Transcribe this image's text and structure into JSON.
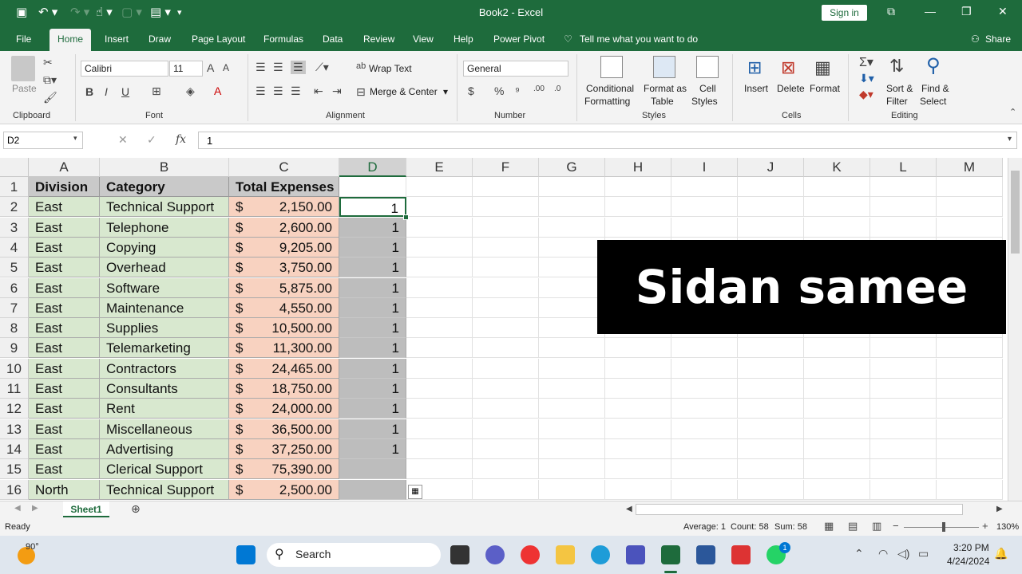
{
  "window": {
    "title": "Book2  -  Excel",
    "sign_in": "Sign in"
  },
  "tabs": [
    "File",
    "Home",
    "Insert",
    "Draw",
    "Page Layout",
    "Formulas",
    "Data",
    "Review",
    "View",
    "Help",
    "Power Pivot"
  ],
  "tell_me": "Tell me what you want to do",
  "share": "Share",
  "ribbon": {
    "clipboard": {
      "paste": "Paste",
      "label": "Clipboard"
    },
    "font": {
      "name": "Calibri",
      "size": "11",
      "label": "Font",
      "bold": "B",
      "italic": "I",
      "underline": "U"
    },
    "alignment": {
      "wrap_text": "Wrap Text",
      "merge_center": "Merge & Center",
      "label": "Alignment"
    },
    "number": {
      "format": "General",
      "currency": "$",
      "percent": "%",
      "comma": "⁹",
      "label": "Number"
    },
    "styles": {
      "conditional": "Conditional",
      "formatting": "Formatting",
      "format_as": "Format as",
      "table": "Table",
      "cell": "Cell",
      "cell_styles": "Styles",
      "label": "Styles"
    },
    "cells": {
      "insert": "Insert",
      "delete": "Delete",
      "format": "Format",
      "label": "Cells"
    },
    "editing": {
      "sort": "Sort &",
      "filter": "Filter",
      "find": "Find &",
      "select": "Select",
      "label": "Editing"
    }
  },
  "formula_bar": {
    "name_box": "D2",
    "fx": "fx",
    "value": "1"
  },
  "columns": [
    "A",
    "B",
    "C",
    "D",
    "E",
    "F",
    "G",
    "H",
    "I",
    "J",
    "K",
    "L",
    "M"
  ],
  "headers": {
    "division": "Division",
    "category": "Category",
    "total": "Total Expenses"
  },
  "rows": [
    {
      "n": "2",
      "division": "East",
      "category": "Technical Support",
      "cur": "$",
      "amount": "2,150.00",
      "d": "1"
    },
    {
      "n": "3",
      "division": "East",
      "category": "Telephone",
      "cur": "$",
      "amount": "2,600.00",
      "d": "1"
    },
    {
      "n": "4",
      "division": "East",
      "category": "Copying",
      "cur": "$",
      "amount": "9,205.00",
      "d": "1"
    },
    {
      "n": "5",
      "division": "East",
      "category": "Overhead",
      "cur": "$",
      "amount": "3,750.00",
      "d": "1"
    },
    {
      "n": "6",
      "division": "East",
      "category": "Software",
      "cur": "$",
      "amount": "5,875.00",
      "d": "1"
    },
    {
      "n": "7",
      "division": "East",
      "category": "Maintenance",
      "cur": "$",
      "amount": "4,550.00",
      "d": "1"
    },
    {
      "n": "8",
      "division": "East",
      "category": "Supplies",
      "cur": "$",
      "amount": "10,500.00",
      "d": "1"
    },
    {
      "n": "9",
      "division": "East",
      "category": "Telemarketing",
      "cur": "$",
      "amount": "11,300.00",
      "d": "1"
    },
    {
      "n": "10",
      "division": "East",
      "category": "Contractors",
      "cur": "$",
      "amount": "24,465.00",
      "d": "1"
    },
    {
      "n": "11",
      "division": "East",
      "category": "Consultants",
      "cur": "$",
      "amount": "18,750.00",
      "d": "1"
    },
    {
      "n": "12",
      "division": "East",
      "category": "Rent",
      "cur": "$",
      "amount": "24,000.00",
      "d": "1"
    },
    {
      "n": "13",
      "division": "East",
      "category": "Miscellaneous",
      "cur": "$",
      "amount": "36,500.00",
      "d": "1"
    },
    {
      "n": "14",
      "division": "East",
      "category": "Advertising",
      "cur": "$",
      "amount": "37,250.00",
      "d": "1"
    },
    {
      "n": "15",
      "division": "East",
      "category": "Clerical Support",
      "cur": "$",
      "amount": "75,390.00",
      "d": ""
    },
    {
      "n": "16",
      "division": "North",
      "category": "Technical Support",
      "cur": "$",
      "amount": "2,500.00",
      "d": ""
    }
  ],
  "banner": "Sidan samee",
  "sheet": "Sheet1",
  "status": {
    "ready": "Ready",
    "average": "Average: 1",
    "count": "Count: 58",
    "sum": "Sum: 58",
    "zoom": "130%"
  },
  "taskbar": {
    "weather": "90°",
    "search": "Search",
    "time": "3:20 PM",
    "date": "4/24/2024",
    "badge": "1"
  }
}
